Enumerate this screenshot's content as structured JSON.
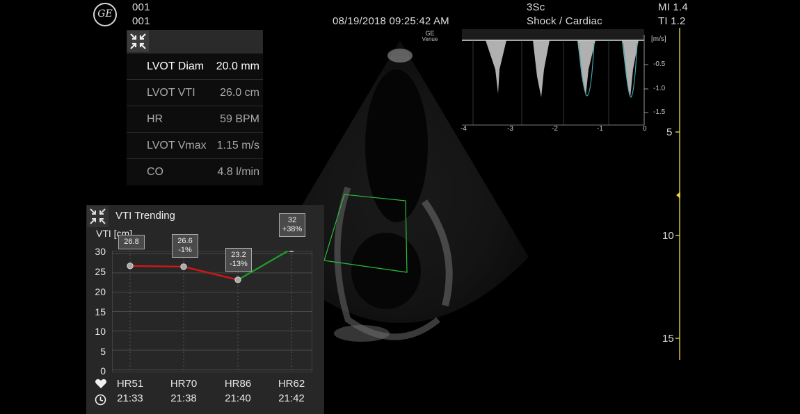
{
  "header": {
    "line1_left": "001",
    "line2_left": "001",
    "datetime": "08/19/2018 09:25:42 AM",
    "probe": "3Sc",
    "preset": "Shock / Cardiac",
    "mi": "MI 1.4",
    "ti": "TI 1.2",
    "brand_small": "GE",
    "device_small": "Venue",
    "logo_text": "GE"
  },
  "measurements": [
    {
      "label": "LVOT Diam",
      "value": "20.0 mm",
      "highlighted": true
    },
    {
      "label": "LVOT VTI",
      "value": "26.0 cm",
      "highlighted": false
    },
    {
      "label": "HR",
      "value": "59 BPM",
      "highlighted": false
    },
    {
      "label": "LVOT Vmax",
      "value": "1.15 m/s",
      "highlighted": false
    },
    {
      "label": "CO",
      "value": "4.8 l/min",
      "highlighted": false
    }
  ],
  "doppler": {
    "unit": "[m/s]",
    "y_ticks": [
      "-0.5",
      "-1.0",
      "-1.5"
    ],
    "x_ticks": [
      "-4",
      "-3",
      "-2",
      "-1",
      "0"
    ]
  },
  "depth_scale": {
    "marks": [
      "5",
      "10",
      "15"
    ]
  },
  "vti_trending": {
    "title": "VTI Trending",
    "y_axis_label": "VTI [cm]",
    "y_ticks": [
      "30",
      "25",
      "20",
      "15",
      "10",
      "5",
      "0"
    ],
    "points": [
      {
        "value": 26.8,
        "box_line1": "26.8",
        "box_line2": "",
        "hr": "HR51",
        "time": "21:33"
      },
      {
        "value": 26.6,
        "box_line1": "26.6",
        "box_line2": "-1%",
        "hr": "HR70",
        "time": "21:38"
      },
      {
        "value": 23.2,
        "box_line1": "23.2",
        "box_line2": "-13%",
        "hr": "HR86",
        "time": "21:40"
      },
      {
        "value": 32,
        "box_line1": "32",
        "box_line2": "+38%",
        "hr": "HR62",
        "time": "21:42"
      }
    ],
    "colors": {
      "decrease": "#d01818",
      "increase": "#1f9a2a"
    }
  },
  "chart_data": {
    "type": "line",
    "title": "VTI Trending",
    "categories": [
      "21:33",
      "21:38",
      "21:40",
      "21:42"
    ],
    "series": [
      {
        "name": "VTI",
        "values": [
          26.8,
          26.6,
          23.2,
          32
        ]
      }
    ],
    "ylabel": "VTI [cm]",
    "ylim": [
      0,
      30
    ]
  }
}
